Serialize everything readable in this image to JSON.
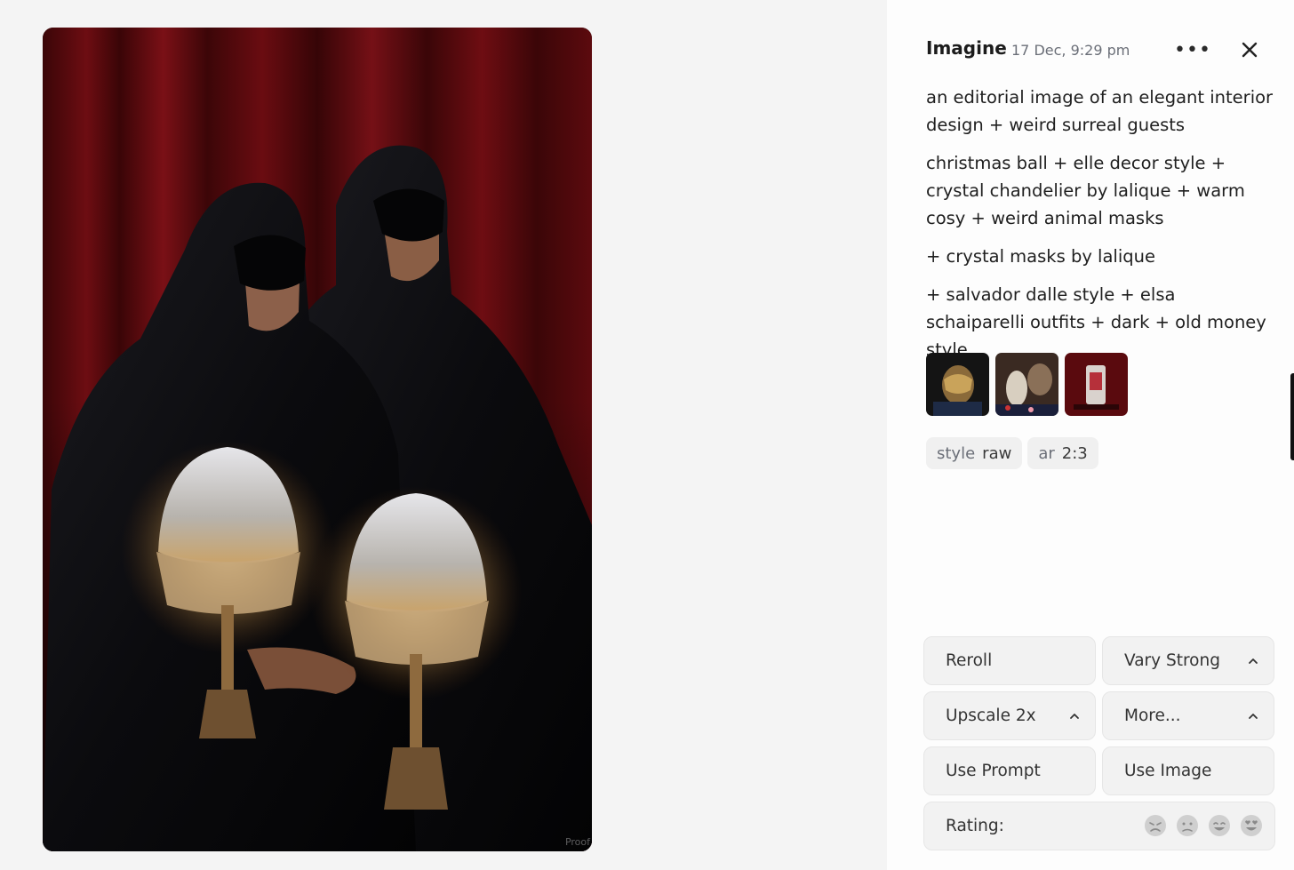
{
  "viewer": {
    "watermark": "Proof"
  },
  "panel": {
    "title": "Imagine",
    "timestamp": "17 Dec, 9:29 pm",
    "more_icon": "ellipsis-icon",
    "close_icon": "close-icon",
    "prompt": [
      "an editorial image of an elegant interior design + weird surreal guests",
      "christmas ball + elle decor style + crystal chandelier by lalique + warm cosy + weird animal masks",
      "+ crystal masks by lalique",
      "+ salvador dalle style + elsa schaiparelli outfits + dark + old money style"
    ],
    "tags": [
      {
        "key": "style",
        "value": "raw"
      },
      {
        "key": "ar",
        "value": "2:3"
      }
    ],
    "actions": {
      "reroll": "Reroll",
      "vary": "Vary Strong",
      "upscale": "Upscale 2x",
      "more": "More...",
      "use_prompt": "Use Prompt",
      "use_image": "Use Image",
      "rating_label": "Rating:"
    },
    "rating_faces": [
      "crying-face-icon",
      "sad-face-icon",
      "smiling-face-icon",
      "heart-eyes-face-icon"
    ]
  }
}
